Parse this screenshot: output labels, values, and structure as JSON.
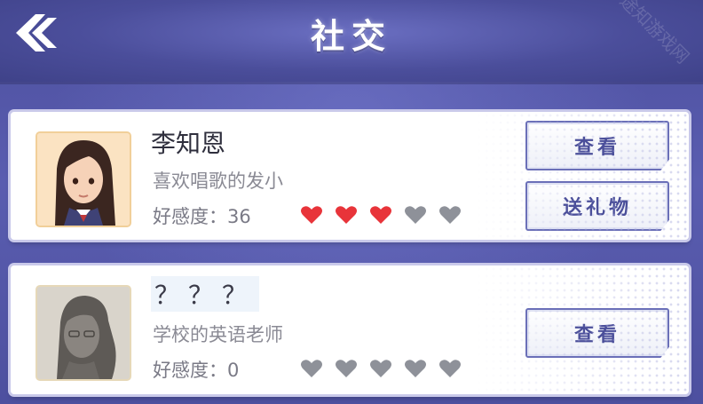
{
  "header": {
    "title": "社交"
  },
  "watermark": "途知游戏网",
  "characters": [
    {
      "name": "李知恩",
      "description": "喜欢唱歌的发小",
      "affinity_label": "好感度：36",
      "affinity_value": 36,
      "hearts_filled": 3,
      "hearts_total": 5,
      "avatar_icon": "girl-portrait",
      "buttons": {
        "view": "查看",
        "gift": "送礼物"
      }
    },
    {
      "name": "？？？",
      "description": "学校的英语老师",
      "affinity_label": "好感度：0",
      "affinity_value": 0,
      "hearts_filled": 0,
      "hearts_total": 5,
      "avatar_icon": "silhouette-portrait",
      "buttons": {
        "view": "查看"
      }
    }
  ],
  "colors": {
    "heart_filled": "#e8343a",
    "heart_empty": "#8e9199",
    "accent": "#4b4f9a"
  }
}
